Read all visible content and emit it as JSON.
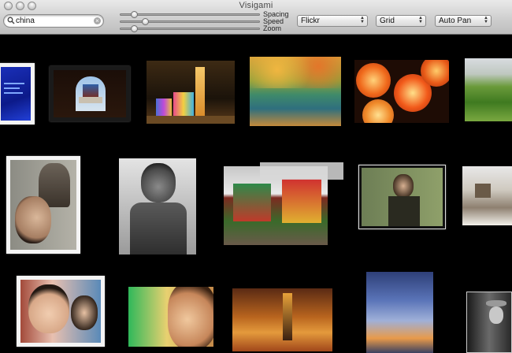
{
  "window": {
    "title": "Visigami"
  },
  "search": {
    "value": "china",
    "placeholder": ""
  },
  "sliders": [
    {
      "label": "Spacing",
      "value": 0.1
    },
    {
      "label": "Speed",
      "value": 0.18
    },
    {
      "label": "Zoom",
      "value": 0.1
    }
  ],
  "popups": {
    "source": "Flickr",
    "layout": "Grid",
    "pan": "Auto Pan"
  },
  "icons": {
    "search": "magnifier-icon",
    "clear": "clear-circle-icon",
    "popup_arrows": "up-down-arrows-icon"
  },
  "photos": [
    {
      "id": "blue-poster"
    },
    {
      "id": "temple-of-heaven-gate"
    },
    {
      "id": "lit-pagoda-night"
    },
    {
      "id": "autumn-lake"
    },
    {
      "id": "red-lanterns"
    },
    {
      "id": "green-terraces"
    },
    {
      "id": "portrait-woman-collage"
    },
    {
      "id": "bw-girl-pointing"
    },
    {
      "id": "chinatown-gate"
    },
    {
      "id": "woman-green-room"
    },
    {
      "id": "great-wall-snow"
    },
    {
      "id": "child-portrait"
    },
    {
      "id": "face-green-bokeh"
    },
    {
      "id": "street-walker"
    },
    {
      "id": "cloudy-sky-sunset"
    },
    {
      "id": "bw-hat-man"
    }
  ]
}
